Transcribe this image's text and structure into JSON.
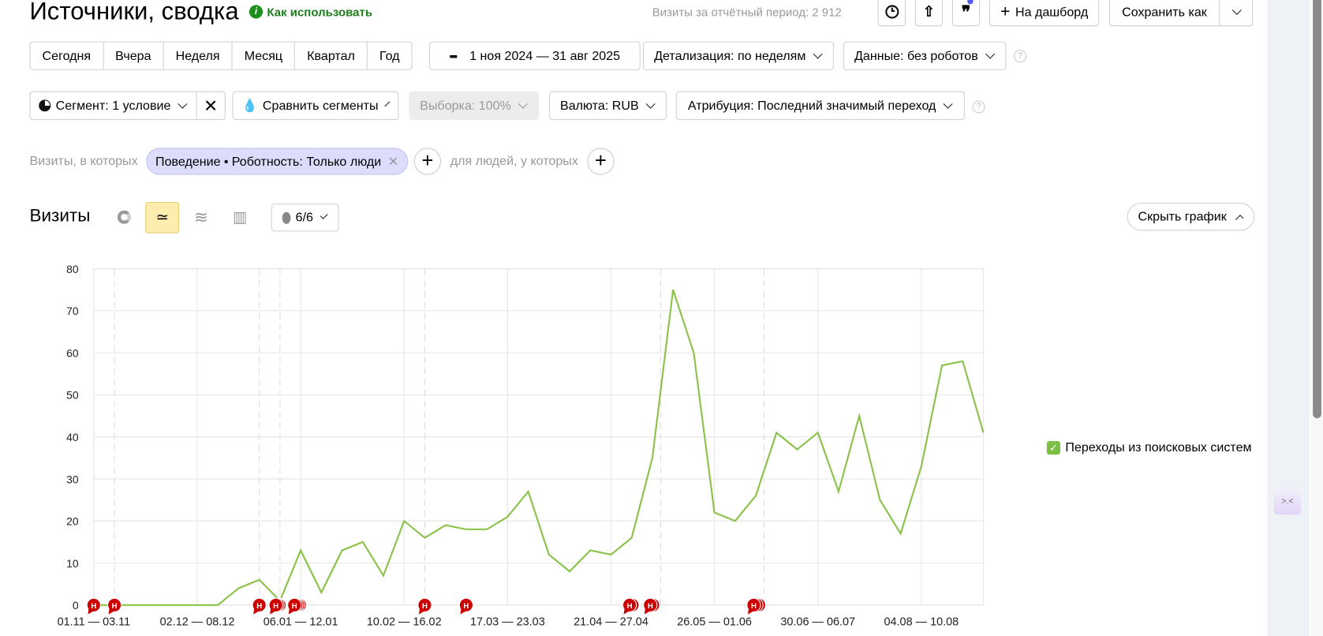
{
  "header": {
    "title": "Источники, сводка",
    "how_to_use": "Как использовать",
    "visits_total_label": "Визиты за отчётный период: 2 912",
    "to_dashboard": "На дашборд",
    "save_as": "Сохранить как"
  },
  "periods": [
    "Сегодня",
    "Вчера",
    "Неделя",
    "Месяц",
    "Квартал",
    "Год"
  ],
  "date_range": "1 ноя 2024 — 31 авг 2025",
  "detail": "Детализация: по неделям",
  "data_filter": "Данные: без роботов",
  "segment": "Сегмент: 1 условие",
  "compare": "Сравнить сегменты",
  "sample": "Выборка: 100%",
  "currency": "Валюта: RUB",
  "attribution": "Атрибуция: Последний значимый переход",
  "filter": {
    "visits_label": "Визиты, в которых",
    "chip_group": "Поведение",
    "chip_text": "Роботность: Только люди",
    "people_label": "для людей, у которых"
  },
  "chart_header": {
    "title": "Визиты",
    "notes": "6/6",
    "hide_chart": "Скрыть график"
  },
  "colors": {
    "line": "#8bc34a",
    "marker": "#cc0000",
    "active_view": "#fdeeb0",
    "chip": "#dcdcfb"
  },
  "chart_data": {
    "type": "line",
    "ylim": [
      0,
      80
    ],
    "yticks": [
      0,
      10,
      20,
      30,
      40,
      50,
      60,
      70,
      80
    ],
    "grid": true,
    "legend_position": "right",
    "xtick_labels": [
      "01.11 — 03.11",
      "02.12 — 08.12",
      "06.01 — 12.01",
      "10.02 — 16.02",
      "17.03 — 23.03",
      "21.04 — 27.04",
      "26.05 — 01.06",
      "30.06 — 06.07",
      "04.08 — 10.08"
    ],
    "series": [
      {
        "name": "Переходы из поисковых систем",
        "values": [
          0,
          0,
          0,
          0,
          0,
          0,
          0,
          4,
          6,
          1,
          13,
          3,
          13,
          15,
          7,
          20,
          16,
          19,
          18,
          18,
          21,
          27,
          12,
          8,
          13,
          12,
          16,
          35,
          75,
          60,
          22,
          20,
          26,
          41,
          37,
          41,
          27,
          45,
          25,
          17,
          33,
          57,
          58,
          41
        ]
      }
    ],
    "note_marker_label": "Н"
  }
}
